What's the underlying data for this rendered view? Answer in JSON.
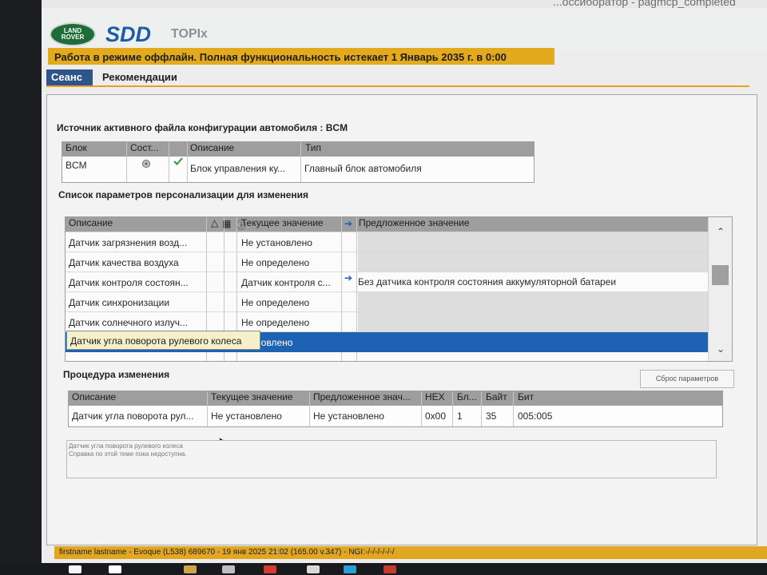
{
  "window": {
    "title_fragment": "...оссиборатор - pagmcp_completed"
  },
  "header": {
    "logo_top": "LAND",
    "logo_bottom": "ROVER",
    "brand": "SDD",
    "product": "TOPIx",
    "offline": "Работа в режиме оффлайн. Полная функциональность истекает 1 Январь 2035 г. в 0:00"
  },
  "tabs": [
    {
      "label": "Сеанс"
    },
    {
      "label": "Рекомендации"
    }
  ],
  "active_config": {
    "title": "Источник активного файла конфигурации автомобиля : BCM",
    "headers": [
      "Блок",
      "Сост...",
      "",
      "Описание",
      "Тип"
    ],
    "row": [
      "BCM",
      "",
      "",
      "Блок управления ку...",
      "Главный блок автомобиля"
    ]
  },
  "param_list": {
    "title": "Список параметров персонализации для изменения",
    "headers": [
      "Описание",
      "",
      "",
      "Текущее значение",
      "",
      "Предложенное значение"
    ],
    "rows": [
      {
        "description": "Датчик загрязнения возд...",
        "current": "Не установлено",
        "proposed": ""
      },
      {
        "description": "Датчик качества воздуха",
        "current": "Не определено",
        "proposed": ""
      },
      {
        "description": "Датчик контроля состоян...",
        "current": "Датчик контроля с...",
        "proposed": "Без датчика контроля состояния аккумуляторной батареи"
      },
      {
        "description": "Датчик синхронизации",
        "current": "Не определено",
        "proposed": ""
      },
      {
        "description": "Датчик солнечного излуч...",
        "current": "Не определено",
        "proposed": ""
      },
      {
        "description": "",
        "current": "становлено",
        "proposed": ""
      }
    ],
    "tooltip": "Датчик угла поворота рулевого колеса"
  },
  "procedure": {
    "title": "Процедура изменения",
    "reset_button": "Сброс параметров",
    "headers": [
      "Описание",
      "Текущее значение",
      "Предложенное знач...",
      "HEX",
      "Бл...",
      "Байт",
      "Бит"
    ],
    "row": [
      "Датчик угла поворота рул...",
      "Не установлено",
      "Не установлено",
      "0x00",
      "1",
      "35",
      "005:005"
    ]
  },
  "help": {
    "line1": "Датчик угла поворота рулевого колеса",
    "line2": "Справка по этой теме пока недоступна."
  },
  "status": {
    "text": "firstname lastname - Evoque (L538) 689670 - 19 янв 2025 21:02 (165.00 v.347) - NGI:-/-/-/-/-/-/"
  },
  "colors": {
    "accent": "#e3aa1e",
    "tab_active": "#2f548c",
    "selection": "#1e63b3",
    "brand": "#1e5ba8",
    "header_gray": "#9e9e9e"
  },
  "icons": {
    "status": "settings-icon",
    "ok": "checkmark-icon",
    "sort": "sort-up-icon",
    "arrow": "arrow-right-icon"
  }
}
